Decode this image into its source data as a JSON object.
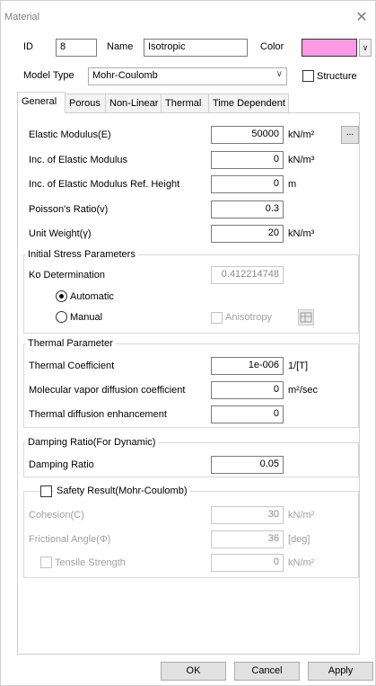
{
  "window": {
    "title": "Material",
    "close_glyph": "✕"
  },
  "header": {
    "id_label": "ID",
    "id_value": "8",
    "name_label": "Name",
    "name_value": "Isotropic",
    "color_label": "Color",
    "color_value": "#ff99e6",
    "model_type_label": "Model Type",
    "model_type_value": "Mohr-Coulomb",
    "structure_label": "Structure",
    "structure_checked": false
  },
  "tabs": [
    {
      "label": "General",
      "active": true
    },
    {
      "label": "Porous",
      "active": false
    },
    {
      "label": "Non-Linear",
      "active": false
    },
    {
      "label": "Thermal",
      "active": false
    },
    {
      "label": "Time Dependent",
      "active": false
    }
  ],
  "general": {
    "elastic_modulus": {
      "label": "Elastic Modulus(E)",
      "value": "50000",
      "unit": "kN/m²"
    },
    "inc_elastic_modulus": {
      "label": "Inc. of Elastic Modulus",
      "value": "0",
      "unit": "kN/m³"
    },
    "inc_ref_height": {
      "label": "Inc. of Elastic Modulus Ref. Height",
      "value": "0",
      "unit": "m"
    },
    "poissons_ratio": {
      "label": "Poisson's Ratio(v)",
      "value": "0.3"
    },
    "unit_weight": {
      "label": "Unit Weight(γ)",
      "value": "20",
      "unit": "kN/m³"
    },
    "more_button": "..."
  },
  "initial_stress": {
    "title": "Initial Stress Parameters",
    "ko_label": "Ko Determination",
    "ko_value": "0.412214748",
    "automatic_label": "Automatic",
    "manual_label": "Manual",
    "selected": "Automatic",
    "anisotropy_label": "Anisotropy"
  },
  "thermal": {
    "title": "Thermal Parameter",
    "coef_label": "Thermal Coefficient",
    "coef_value": "1e-006",
    "coef_unit": "1/[T]",
    "vapor_label": "Molecular vapor diffusion coefficient",
    "vapor_value": "0",
    "vapor_unit": "m²/sec",
    "enh_label": "Thermal diffusion enhancement",
    "enh_value": "0"
  },
  "damping": {
    "title": "Damping Ratio(For Dynamic)",
    "label": "Damping Ratio",
    "value": "0.05"
  },
  "safety": {
    "title": "Safety Result(Mohr-Coulomb)",
    "checked": false,
    "cohesion_label": "Cohesion(C)",
    "cohesion_value": "30",
    "cohesion_unit": "kN/m²",
    "friction_label": "Frictional Angle(Φ)",
    "friction_value": "36",
    "friction_unit": "[deg]",
    "tensile_label": "Tensile Strength",
    "tensile_value": "0",
    "tensile_unit": "kN/m²"
  },
  "footer": {
    "ok": "OK",
    "cancel": "Cancel",
    "apply": "Apply"
  }
}
